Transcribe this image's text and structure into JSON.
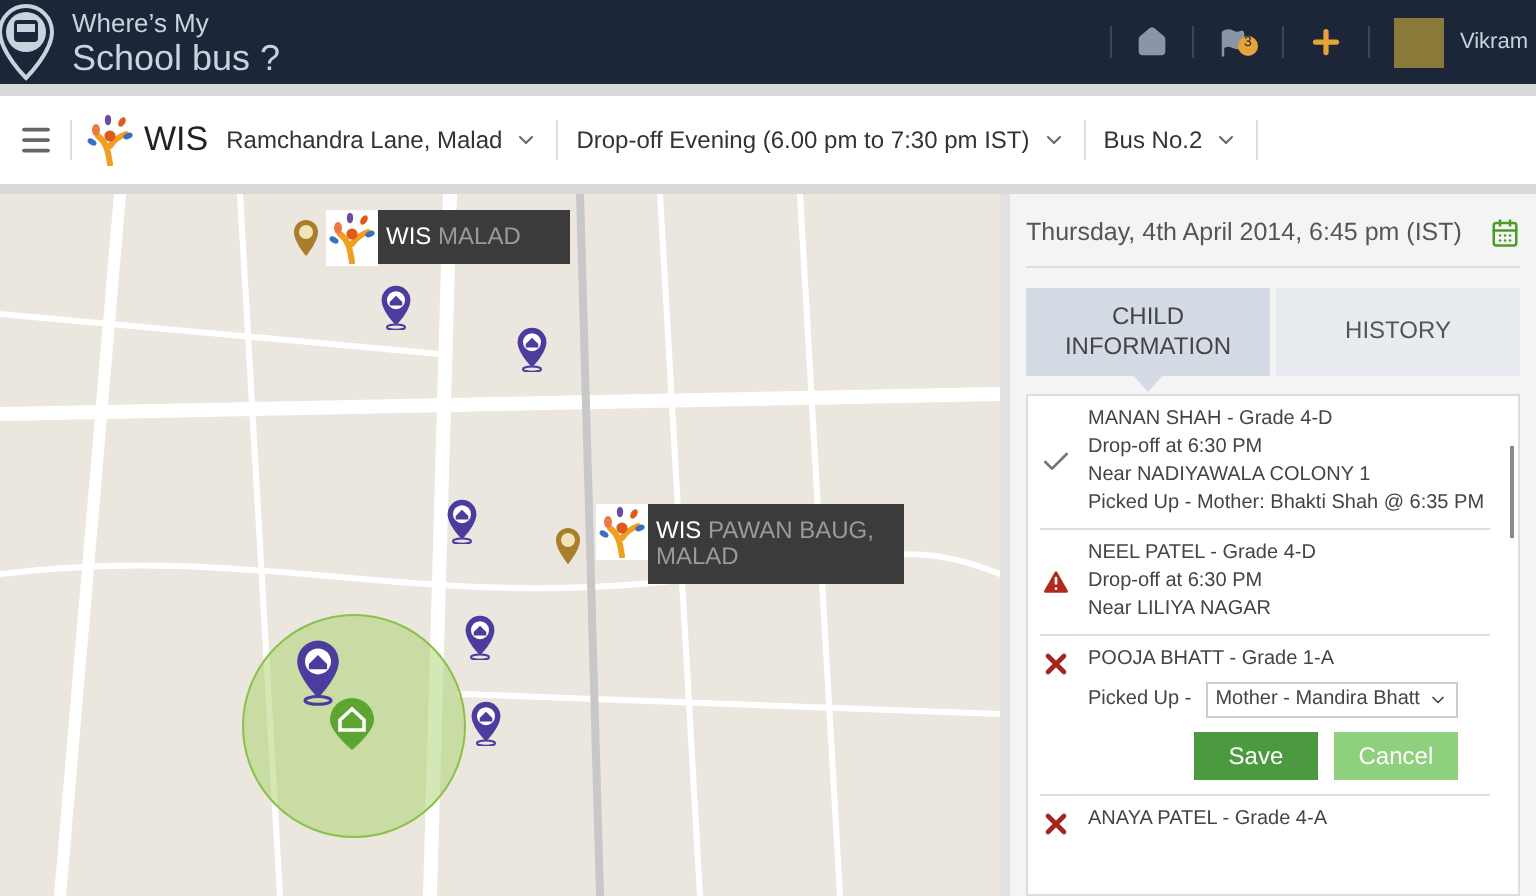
{
  "app": {
    "title_line1": "Where’s My",
    "title_line2": "School bus ?"
  },
  "header": {
    "notification_count": "3",
    "user_name": "Vikram"
  },
  "toolbar": {
    "brand": "WIS",
    "filters": [
      "Ramchandra Lane, Malad",
      "Drop-off Evening (6.00 pm to 7:30 pm IST)",
      "Bus No.2"
    ]
  },
  "map": {
    "school_labels": [
      {
        "name": "WIS",
        "place": "MALAD"
      },
      {
        "name": "WIS",
        "place": "PAWAN BAUG, MALAD"
      }
    ]
  },
  "panel": {
    "datetime": "Thursday, 4th April 2014, 6:45 pm (IST)",
    "tabs": [
      {
        "label": "CHILD INFORMATION",
        "selected": true
      },
      {
        "label": "HISTORY",
        "selected": false
      }
    ],
    "children": [
      {
        "kind": "done",
        "lines": [
          "MANAN SHAH - Grade 4-D",
          "Drop-off at 6:30 PM",
          "Near NADIYAWALA COLONY 1",
          "Picked Up - Mother: Bhakti Shah @ 6:35 PM"
        ]
      },
      {
        "kind": "alert",
        "lines": [
          "NEEL PATEL - Grade 4-D",
          "Drop-off at 6:30 PM",
          "Near LILIYA NAGAR"
        ]
      },
      {
        "kind": "missed",
        "lines": [
          "POOJA BHATT - Grade 1-A"
        ],
        "pickup": {
          "label": "Picked Up -",
          "value": "Mother - Mandira Bhatt"
        },
        "actions": [
          "Save",
          "Cancel"
        ]
      },
      {
        "kind": "missed",
        "lines": [
          "ANAYA PATEL  - Grade 4-A"
        ]
      }
    ]
  }
}
